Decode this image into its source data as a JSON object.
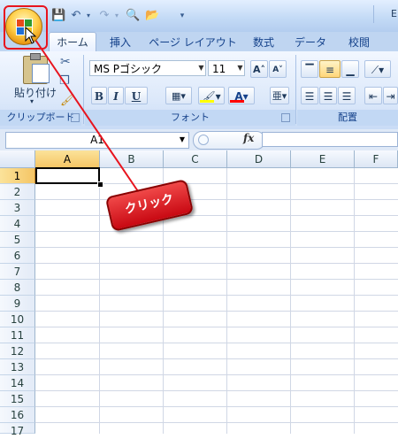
{
  "window": {
    "title_fragment": "E"
  },
  "quick_access": {
    "save_icon": "save-icon",
    "undo_icon": "undo-icon",
    "redo_icon": "redo-icon",
    "preview_icon": "print-preview-icon",
    "open_icon": "open-folder-icon",
    "customize_icon": "qat-customize-icon"
  },
  "tabs": [
    {
      "label": "ホーム",
      "active": true
    },
    {
      "label": "挿入"
    },
    {
      "label": "ページ レイアウト"
    },
    {
      "label": "数式"
    },
    {
      "label": "データ"
    },
    {
      "label": "校閲"
    }
  ],
  "ribbon": {
    "clipboard": {
      "paste_label": "貼り付け",
      "group_label": "クリップボード"
    },
    "font": {
      "font_name": "MS Pゴシック",
      "font_size": "11",
      "grow_label": "A˄",
      "shrink_label": "A˅",
      "bold_label": "B",
      "italic_label": "I",
      "underline_label": "U",
      "font_color_label": "A",
      "group_label": "フォント",
      "fill_color": "#ffff00",
      "font_color": "#ff0000"
    },
    "alignment": {
      "group_label": "配置"
    }
  },
  "formula_bar": {
    "name_box": "A1",
    "fx_label": "fx",
    "formula": ""
  },
  "sheet": {
    "columns": [
      "A",
      "B",
      "C",
      "D",
      "E",
      "F"
    ],
    "rows": [
      "1",
      "2",
      "3",
      "4",
      "5",
      "6",
      "7",
      "8",
      "9",
      "10",
      "11",
      "12",
      "13",
      "14",
      "15",
      "16",
      "17"
    ],
    "active_cell": "A1"
  },
  "annotation": {
    "callout_text": "クリック",
    "highlight_color": "#e8141e"
  }
}
